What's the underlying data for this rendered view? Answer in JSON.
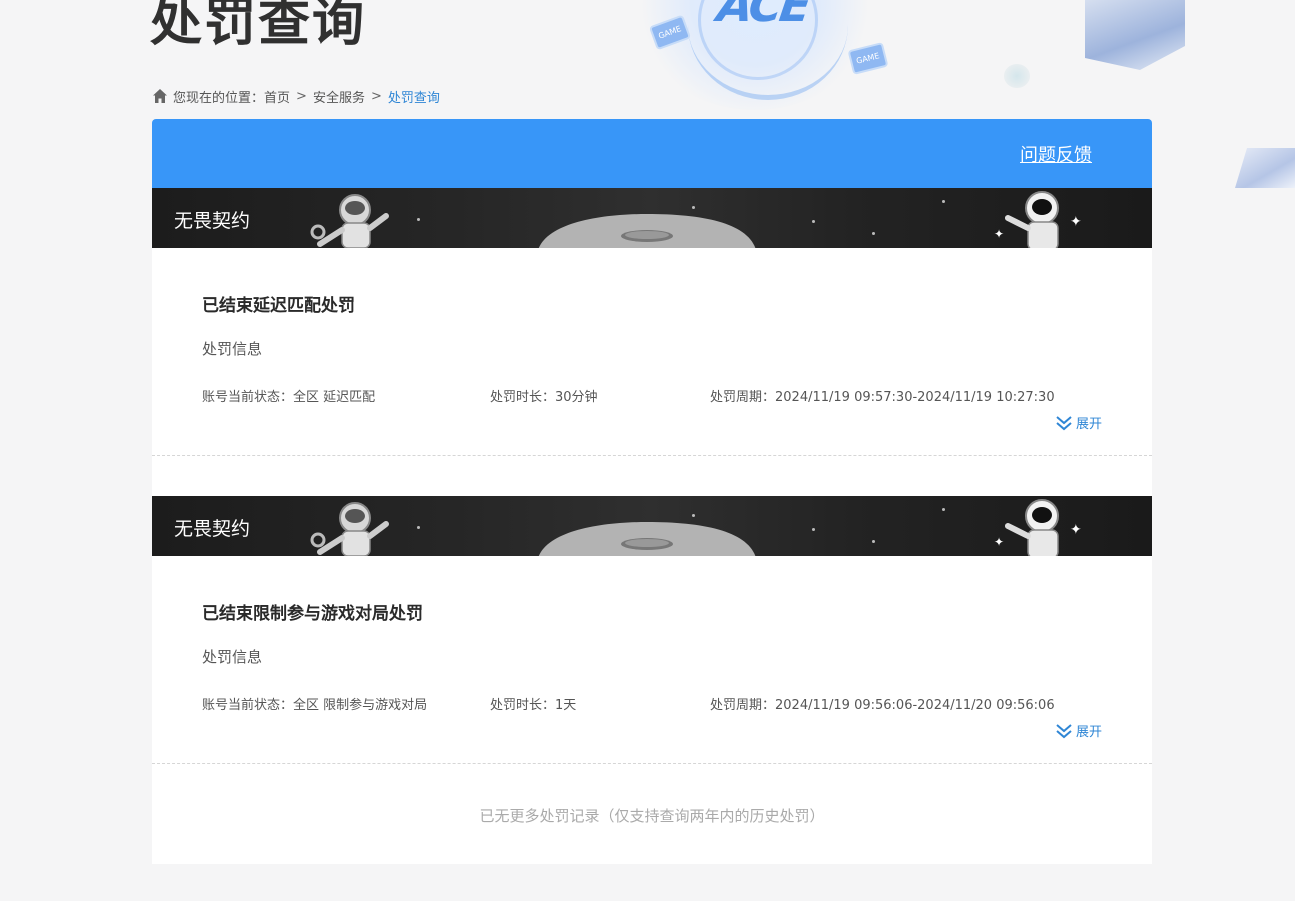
{
  "page": {
    "title": "处罚查询"
  },
  "breadcrumb": {
    "prefix": "您现在的位置：",
    "items": [
      "首页",
      "安全服务",
      "处罚查询"
    ],
    "separator": ">"
  },
  "header": {
    "feedback_label": "问题反馈",
    "color": "#3896f8"
  },
  "records": [
    {
      "banner_title": "无畏契约",
      "heading": "已结束延迟匹配处罚",
      "info_label": "处罚信息",
      "status_label": "账号当前状态：",
      "status_value": "全区 延迟匹配",
      "duration_label": "处罚时长：",
      "duration_value": "30分钟",
      "period_label": "处罚周期：",
      "period_value": "2024/11/19 09:57:30-2024/11/19 10:27:30",
      "expand_label": "展开"
    },
    {
      "banner_title": "无畏契约",
      "heading": "已结束限制参与游戏对局处罚",
      "info_label": "处罚信息",
      "status_label": "账号当前状态：",
      "status_value": "全区 限制参与游戏对局",
      "duration_label": "处罚时长：",
      "duration_value": "1天",
      "period_label": "处罚周期：",
      "period_value": "2024/11/19 09:56:06-2024/11/20 09:56:06",
      "expand_label": "展开"
    }
  ],
  "footer_note": "已无更多处罚记录（仅支持查询两年内的历史处罚）",
  "decor": {
    "logo_text": "ACE",
    "game_tag": "GAME"
  },
  "colors": {
    "accent": "#2f86d5",
    "header_blue": "#3896f8",
    "banner_dark": "#1c1c1c"
  }
}
